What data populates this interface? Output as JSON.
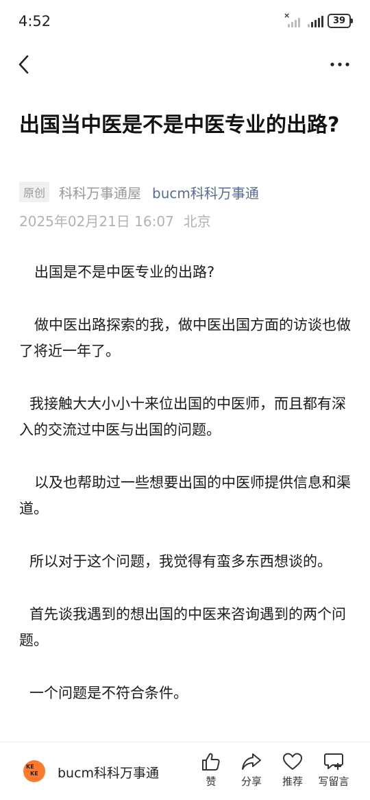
{
  "status_bar": {
    "time": "4:52",
    "battery": "39"
  },
  "article": {
    "title": "出国当中医是不是中医专业的出路?",
    "original_tag": "原创",
    "author": "科科万事通屋",
    "account": "bucm科科万事通",
    "date": "2025年02月21日 16:07",
    "location": "北京",
    "paragraphs": [
      "出国是不是中医专业的出路?",
      "做中医出路探索的我，做中医出国方面的访谈也做了将近一年了。",
      "我接触大大小小十来位出国的中医师，而且都有深入的交流过中医与出国的问题。",
      "以及也帮助过一些想要出国的中医师提供信息和渠道。",
      "所以对于这个问题，我觉得有蛮多东西想谈的。",
      "首先谈我遇到的想出国的中医来咨询遇到的两个问题。",
      "一个问题是不符合条件。"
    ]
  },
  "bottom_bar": {
    "account_name": "bucm科科万事通",
    "avatar_text": [
      "KE",
      "KE"
    ],
    "actions": {
      "like": "赞",
      "share": "分享",
      "recommend": "推荐",
      "comment": "写留言"
    }
  },
  "icons": [
    "back-arrow-icon",
    "more-dots-icon",
    "thumb-up-icon",
    "share-icon",
    "heart-icon",
    "comment-plus-icon"
  ]
}
